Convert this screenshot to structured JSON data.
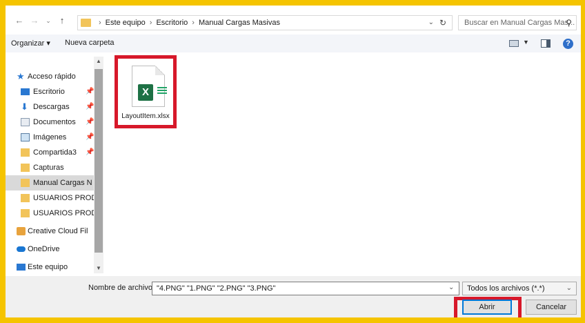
{
  "address": {
    "crumbs": [
      "Este equipo",
      "Escritorio",
      "Manual Cargas Masivas"
    ],
    "refresh_icon": "refresh-icon"
  },
  "search": {
    "placeholder": "Buscar en Manual Cargas Mas..."
  },
  "toolbar": {
    "organize": "Organizar ▾",
    "new_folder": "Nueva carpeta"
  },
  "nav": {
    "items": [
      {
        "label": "Acceso rápido",
        "icon": "star-icon"
      },
      {
        "label": "Escritorio",
        "icon": "desktop-icon"
      },
      {
        "label": "Descargas",
        "icon": "download-icon"
      },
      {
        "label": "Documentos",
        "icon": "documents-icon"
      },
      {
        "label": "Imágenes",
        "icon": "pictures-icon"
      },
      {
        "label": "Compartida3",
        "icon": "shared-folder-icon"
      },
      {
        "label": "Capturas",
        "icon": "folder-icon"
      },
      {
        "label": "Manual Cargas N",
        "icon": "folder-icon"
      },
      {
        "label": "USUARIOS PROD",
        "icon": "folder-icon"
      },
      {
        "label": "USUARIOS PROD",
        "icon": "folder-icon"
      },
      {
        "label": "Creative Cloud Fil",
        "icon": "creative-cloud-icon"
      },
      {
        "label": "OneDrive",
        "icon": "onedrive-icon"
      },
      {
        "label": "Este equipo",
        "icon": "computer-icon"
      }
    ]
  },
  "files": [
    {
      "name": "LayoutItem.xlsx",
      "icon": "excel-file-icon"
    }
  ],
  "bottom": {
    "filename_label": "Nombre de archivo:",
    "filename_value": "\"4.PNG\" \"1.PNG\" \"2.PNG\" \"3.PNG\"",
    "filter": "Todos los archivos (*.*)",
    "open": "Abrir",
    "cancel": "Cancelar"
  },
  "colors": {
    "highlight": "#d7182a",
    "background": "#f5c400",
    "accent": "#0078d7"
  }
}
